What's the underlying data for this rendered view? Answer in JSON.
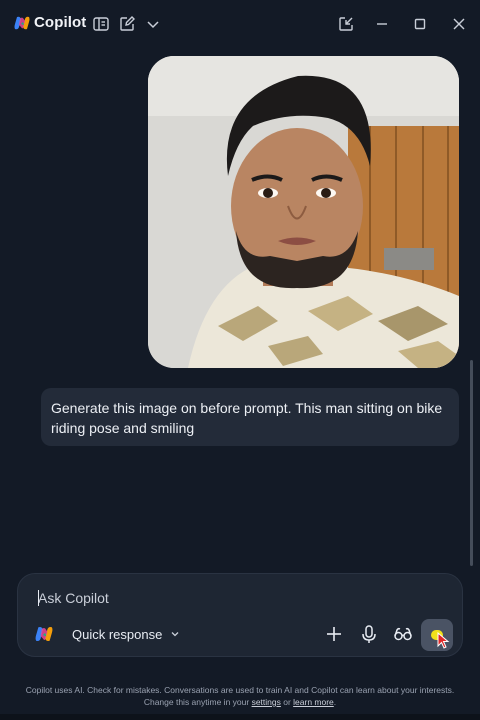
{
  "app": {
    "name": "Copilot",
    "colors": {
      "background": "#131a26",
      "bubble": "#232b39",
      "composer": "#1e2633",
      "send": "#4a5364",
      "accent_dot": "#f2e21a"
    }
  },
  "titlebar": {
    "icons": [
      "sidebar-toggle-icon",
      "new-chat-icon",
      "chevron-down-icon",
      "pop-out-icon",
      "minimize-icon",
      "maximize-icon",
      "close-icon"
    ]
  },
  "conversation": {
    "user_image": "photo of a man in a camouflage shirt",
    "user_message": "Generate this image on before prompt. This man sitting on bike riding pose and smiling"
  },
  "composer": {
    "placeholder": "Ask Copilot",
    "mode_label": "Quick response",
    "icons": [
      "copilot-icon",
      "add-icon",
      "microphone-icon",
      "vision-icon",
      "send-button"
    ]
  },
  "footer": {
    "text_1": "Copilot uses AI. Check for mistakes. Conversations are used to train AI and Copilot can learn about your interests. Change this anytime in your ",
    "settings_link": "settings",
    "or_text": " or ",
    "learn_more_link": "learn more",
    "end_text": "."
  }
}
